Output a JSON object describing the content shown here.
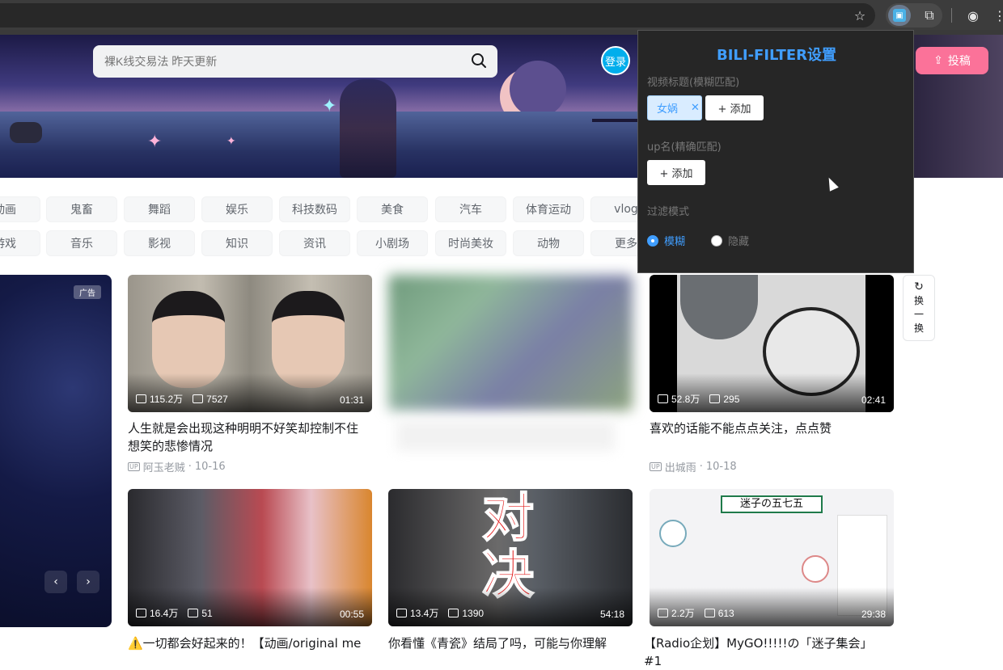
{
  "browser": {
    "icons": [
      "star-icon",
      "bili-filter-extension-icon",
      "extensions-puzzle-icon",
      "profile-icon",
      "more-icon"
    ]
  },
  "header": {
    "search_placeholder": "裸K线交易法 昨天更新",
    "login_label": "登录",
    "upload_label": "投稿"
  },
  "categories": {
    "row1": [
      "动画",
      "鬼畜",
      "舞蹈",
      "娱乐",
      "科技数码",
      "美食",
      "汽车",
      "体育运动",
      "vlog"
    ],
    "row2": [
      "游戏",
      "音乐",
      "影视",
      "知识",
      "资讯",
      "小剧场",
      "时尚美妆",
      "动物",
      "更多"
    ]
  },
  "ad": {
    "badge": "广告"
  },
  "refresh": {
    "label_1": "换",
    "label_2": "一",
    "label_3": "换"
  },
  "videos": [
    {
      "views": "115.2万",
      "danmaku": "7527",
      "duration": "01:31",
      "title": "人生就是会出现这种明明不好笑却控制不住想笑的悲惨情况",
      "up": "阿玉老贼",
      "date": "10-16"
    },
    {
      "views": "",
      "danmaku": "",
      "duration": "",
      "title": "",
      "up": "",
      "date": ""
    },
    {
      "views": "52.8万",
      "danmaku": "295",
      "duration": "02:41",
      "title": "喜欢的话能不能点点关注，点点赞",
      "up": "出城雨",
      "date": "10-18"
    },
    {
      "views": "16.4万",
      "danmaku": "51",
      "duration": "00:55",
      "title": "⚠️一切都会好起来的！【动画/original me",
      "up": "",
      "date": ""
    },
    {
      "views": "13.4万",
      "danmaku": "1390",
      "duration": "54:18",
      "title": "你看懂《青瓷》结局了吗，可能与你理解",
      "up": "",
      "date": ""
    },
    {
      "views": "2.2万",
      "danmaku": "613",
      "duration": "29:38",
      "title": "【Radio企划】MyGO!!!!!の「迷子集会」#1",
      "up": "",
      "date": ""
    }
  ],
  "thumb_text": {
    "v5_big": "对决",
    "v6_sign": "迷子の五七五"
  },
  "popup": {
    "title": "BILI-FILTER设置",
    "title_section_label": "视频标题(模糊匹配)",
    "title_tags": [
      "女娲"
    ],
    "add_label": "+ 添加",
    "up_section_label": "up名(精确匹配)",
    "mode_label": "过滤模式",
    "mode_options": [
      "模糊",
      "隐藏"
    ],
    "mode_selected": "模糊"
  },
  "colors": {
    "accent_blue": "#409eff",
    "bili_pink": "#fb7299",
    "bili_blue": "#00aeec"
  }
}
